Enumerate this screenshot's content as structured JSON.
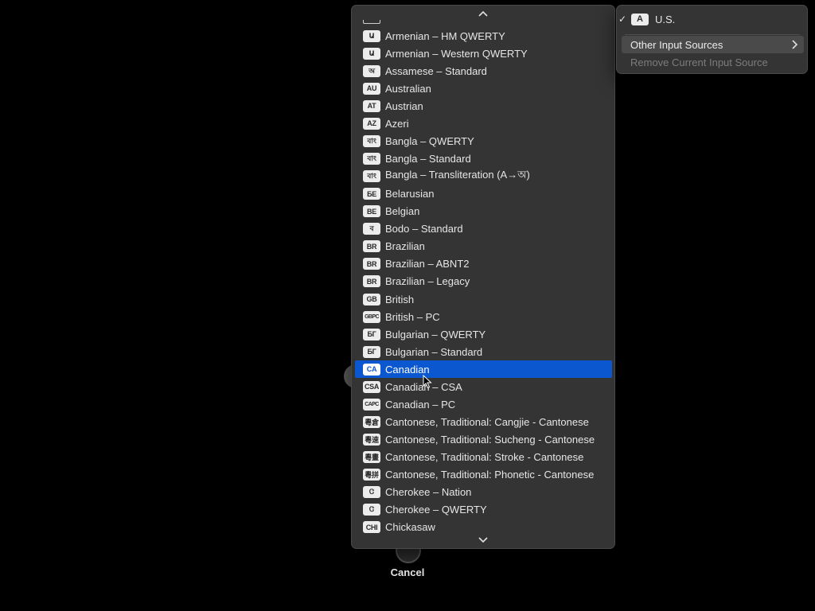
{
  "background": {
    "cancel_label": "Cancel"
  },
  "list_menu": {
    "scroll_up_icon": "chevron-up-icon",
    "scroll_down_icon": "chevron-down-icon",
    "selected_index": 19,
    "items": [
      {
        "badge": "Ա",
        "label": "Armenian – HM QWERTY"
      },
      {
        "badge": "Ա",
        "label": "Armenian – Western QWERTY"
      },
      {
        "badge": "অ",
        "label": "Assamese – Standard"
      },
      {
        "badge": "AU",
        "label": "Australian"
      },
      {
        "badge": "AT",
        "label": "Austrian"
      },
      {
        "badge": "AZ",
        "label": "Azeri"
      },
      {
        "badge": "বাং",
        "label": "Bangla – QWERTY"
      },
      {
        "badge": "বাং",
        "label": "Bangla – Standard"
      },
      {
        "badge": "বাং",
        "label": "Bangla – Transliteration (A→অ)"
      },
      {
        "badge": "БЕ",
        "label": "Belarusian"
      },
      {
        "badge": "BE",
        "label": "Belgian"
      },
      {
        "badge": "ব",
        "label": "Bodo – Standard"
      },
      {
        "badge": "BR",
        "label": "Brazilian"
      },
      {
        "badge": "BR",
        "label": "Brazilian – ABNT2"
      },
      {
        "badge": "BR",
        "label": "Brazilian – Legacy"
      },
      {
        "badge": "GB",
        "label": "British"
      },
      {
        "badge": "GBPC",
        "label": "British – PC"
      },
      {
        "badge": "БГ",
        "label": "Bulgarian – QWERTY"
      },
      {
        "badge": "БГ",
        "label": "Bulgarian – Standard"
      },
      {
        "badge": "CA",
        "label": "Canadian"
      },
      {
        "badge": "CSA",
        "label": "Canadian – CSA"
      },
      {
        "badge": "CAPC",
        "label": "Canadian – PC"
      },
      {
        "badge": "粵倉",
        "label": "Cantonese, Traditional: Cangjie - Cantonese"
      },
      {
        "badge": "粵速",
        "label": "Cantonese, Traditional: Sucheng - Cantonese"
      },
      {
        "badge": "粵畫",
        "label": "Cantonese, Traditional: Stroke - Cantonese"
      },
      {
        "badge": "粵拼",
        "label": "Cantonese, Traditional: Phonetic - Cantonese"
      },
      {
        "badge": "Ꮳ",
        "label": "Cherokee – Nation"
      },
      {
        "badge": "Ꮳ",
        "label": "Cherokee – QWERTY"
      },
      {
        "badge": "CHI",
        "label": "Chickasaw"
      }
    ]
  },
  "input_source_menu": {
    "current": {
      "check": "✓",
      "badge": "A",
      "label": "U.S."
    },
    "other_label": "Other Input Sources",
    "remove_label": "Remove Current Input Source"
  },
  "colors": {
    "menu_bg": "#343434",
    "selection": "#0b57d0",
    "hover": "#4a4a4a",
    "disabled_text": "#7c7c7c"
  }
}
